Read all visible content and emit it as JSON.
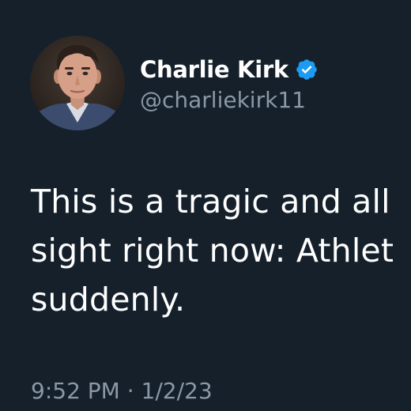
{
  "tweet": {
    "author": {
      "display_name": "Charlie Kirk",
      "handle": "@charliekirk11",
      "verified_icon": "verified-badge-icon",
      "avatar": "profile-photo"
    },
    "body_lines": [
      "This is a tragic and all",
      "sight right now: Athlet",
      "suddenly."
    ],
    "timestamp": "9:52 PM · 1/2/23"
  },
  "colors": {
    "background": "#15202b",
    "text_primary": "#ffffff",
    "text_secondary": "#8b98a5",
    "verified_blue": "#1d9bf0"
  }
}
